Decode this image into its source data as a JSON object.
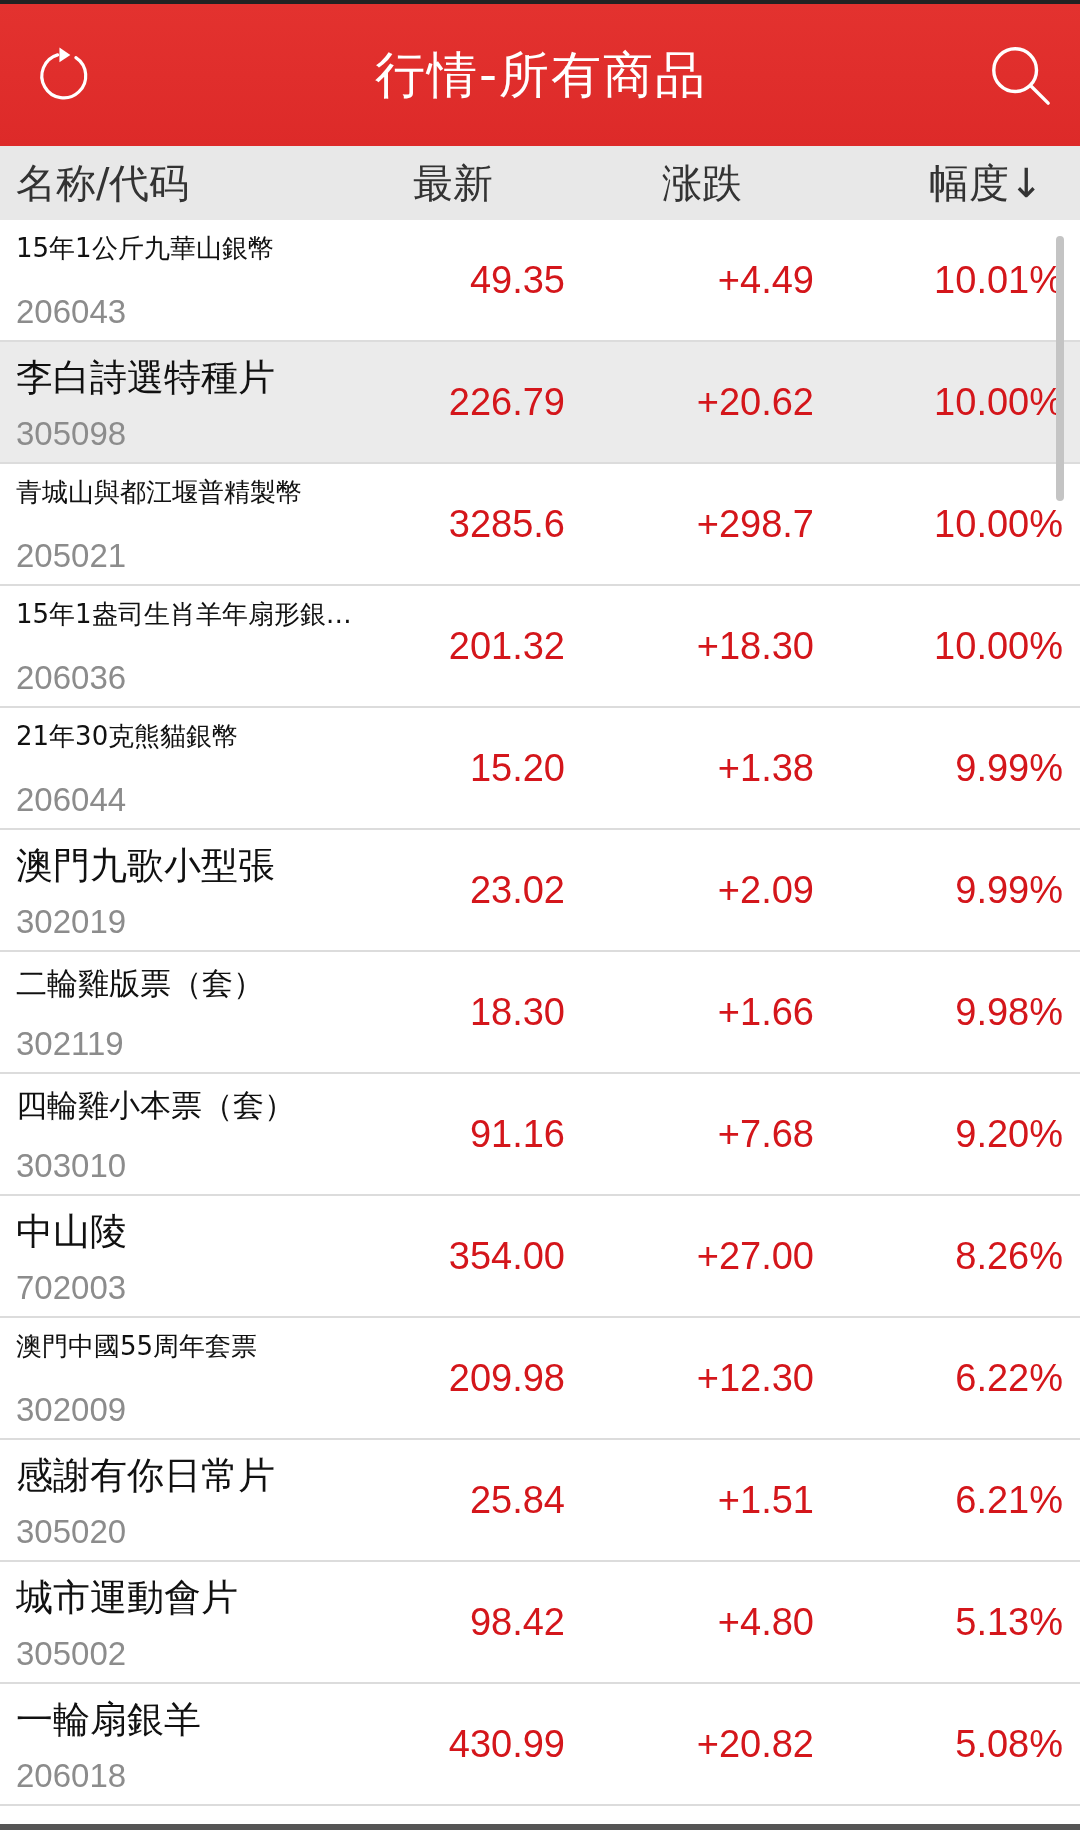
{
  "header": {
    "title": "行情-所有商品"
  },
  "columns": [
    {
      "label": "名称/代码"
    },
    {
      "label": "最新"
    },
    {
      "label": "涨跌"
    },
    {
      "label": "幅度↓"
    }
  ],
  "rows": [
    {
      "name": "15年1公斤九華山銀幣",
      "code": "206043",
      "price": "49.35",
      "change": "+4.49",
      "pct": "10.01%",
      "selected": false
    },
    {
      "name": "李白詩選特種片",
      "code": "305098",
      "price": "226.79",
      "change": "+20.62",
      "pct": "10.00%",
      "selected": true
    },
    {
      "name": "青城山與都江堰普精製幣",
      "code": "205021",
      "price": "3285.6",
      "change": "+298.7",
      "pct": "10.00%",
      "selected": false
    },
    {
      "name": "15年1盎司生肖羊年扇形銀…",
      "code": "206036",
      "price": "201.32",
      "change": "+18.30",
      "pct": "10.00%",
      "selected": false
    },
    {
      "name": "21年30克熊貓銀幣",
      "code": "206044",
      "price": "15.20",
      "change": "+1.38",
      "pct": "9.99%",
      "selected": false
    },
    {
      "name": "澳門九歌小型張",
      "code": "302019",
      "price": "23.02",
      "change": "+2.09",
      "pct": "9.99%",
      "selected": false
    },
    {
      "name": "二輪雞版票（套）",
      "code": "302119",
      "price": "18.30",
      "change": "+1.66",
      "pct": "9.98%",
      "selected": false
    },
    {
      "name": "四輪雞小本票（套）",
      "code": "303010",
      "price": "91.16",
      "change": "+7.68",
      "pct": "9.20%",
      "selected": false
    },
    {
      "name": "中山陵",
      "code": "702003",
      "price": "354.00",
      "change": "+27.00",
      "pct": "8.26%",
      "selected": false
    },
    {
      "name": "澳門中國55周年套票",
      "code": "302009",
      "price": "209.98",
      "change": "+12.30",
      "pct": "6.22%",
      "selected": false
    },
    {
      "name": "感謝有你日常片",
      "code": "305020",
      "price": "25.84",
      "change": "+1.51",
      "pct": "6.21%",
      "selected": false
    },
    {
      "name": "城市運動會片",
      "code": "305002",
      "price": "98.42",
      "change": "+4.80",
      "pct": "5.13%",
      "selected": false
    },
    {
      "name": "一輪扇銀羊",
      "code": "206018",
      "price": "430.99",
      "change": "+20.82",
      "pct": "5.08%",
      "selected": false
    }
  ]
}
